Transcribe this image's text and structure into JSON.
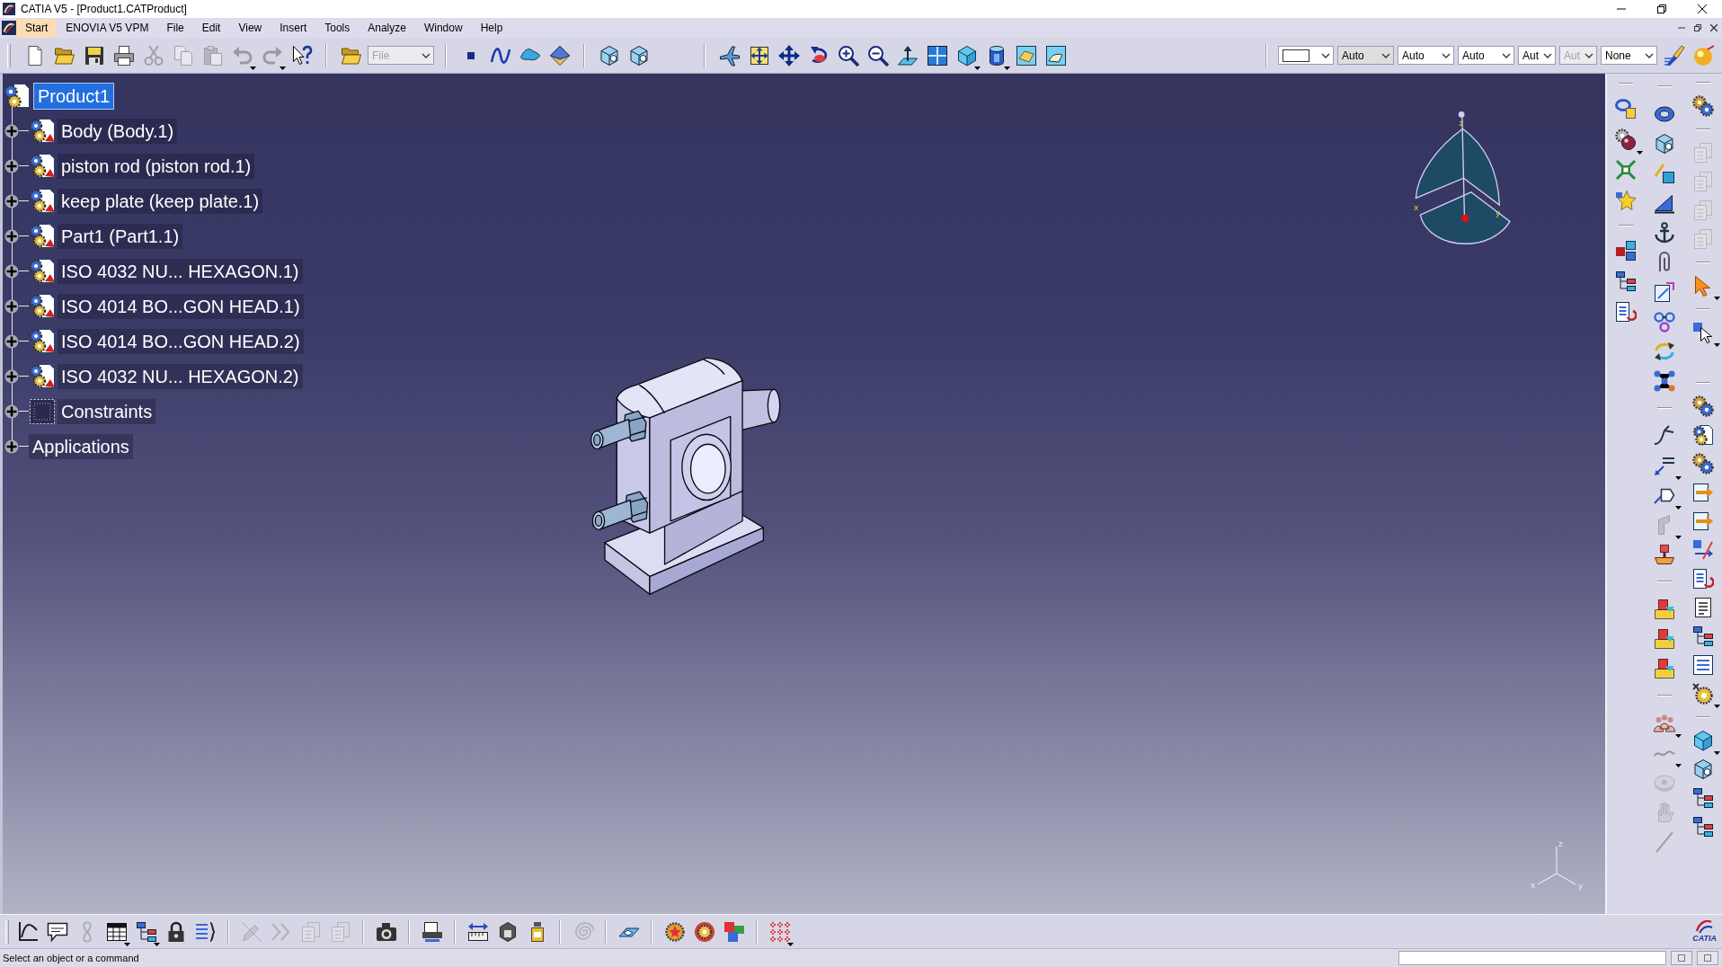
{
  "window": {
    "title": "CATIA V5 - [Product1.CATProduct]"
  },
  "menu": [
    {
      "label": "Start",
      "selected": true
    },
    {
      "label": "ENOVIA V5 VPM",
      "selected": false
    },
    {
      "label": "File",
      "selected": false
    },
    {
      "label": "Edit",
      "selected": false
    },
    {
      "label": "View",
      "selected": false
    },
    {
      "label": "Insert",
      "selected": false
    },
    {
      "label": "Tools",
      "selected": false
    },
    {
      "label": "Analyze",
      "selected": false
    },
    {
      "label": "Window",
      "selected": false
    },
    {
      "label": "Help",
      "selected": false
    }
  ],
  "top_toolbar": {
    "groups": [
      [
        {
          "kind": "doc",
          "disabled": false,
          "dropdown": false
        },
        {
          "kind": "folder",
          "disabled": false,
          "dropdown": false
        },
        {
          "kind": "floppy",
          "disabled": false,
          "dropdown": false
        },
        {
          "kind": "printer",
          "disabled": false,
          "dropdown": false
        },
        {
          "kind": "scissors",
          "disabled": true,
          "dropdown": false
        },
        {
          "kind": "copy",
          "disabled": true,
          "dropdown": false
        },
        {
          "kind": "clipboard",
          "disabled": true,
          "dropdown": false
        },
        {
          "kind": "undo",
          "disabled": true,
          "dropdown": true
        },
        {
          "kind": "redo",
          "disabled": true,
          "dropdown": true
        },
        {
          "kind": "help",
          "disabled": false,
          "dropdown": false
        }
      ],
      [
        {
          "kind": "folder",
          "disabled": false,
          "dropdown": false
        },
        {
          "kind": "combo",
          "value": "File",
          "disabled": true,
          "dropdown": true
        }
      ],
      [
        {
          "kind": "dot",
          "disabled": false,
          "dropdown": false
        },
        {
          "kind": "curve",
          "disabled": false,
          "dropdown": false
        },
        {
          "kind": "surface",
          "disabled": false,
          "dropdown": false
        },
        {
          "kind": "diamond",
          "disabled": false,
          "dropdown": false
        }
      ],
      [
        {
          "kind": "box",
          "disabled": false,
          "dropdown": false
        },
        {
          "kind": "box",
          "disabled": false,
          "dropdown": false
        }
      ],
      [
        {
          "kind": "airplane",
          "disabled": false,
          "dropdown": false
        },
        {
          "kind": "frame-arrows",
          "disabled": false,
          "dropdown": false
        },
        {
          "kind": "move-arrows",
          "disabled": false,
          "dropdown": false
        },
        {
          "kind": "rotate",
          "disabled": false,
          "dropdown": false
        },
        {
          "kind": "zoom-in",
          "disabled": false,
          "dropdown": false
        },
        {
          "kind": "zoom-out",
          "disabled": false,
          "dropdown": false
        },
        {
          "kind": "plane-arrow",
          "disabled": false,
          "dropdown": false
        },
        {
          "kind": "grid",
          "disabled": false,
          "dropdown": false
        },
        {
          "kind": "cube",
          "disabled": false,
          "dropdown": true
        },
        {
          "kind": "cylinder",
          "disabled": false,
          "dropdown": true
        },
        {
          "kind": "tile-diamond",
          "disabled": false,
          "dropdown": false
        },
        {
          "kind": "tile-curve",
          "disabled": false,
          "dropdown": false
        }
      ],
      [
        {
          "kind": "color-combo",
          "disabled": false,
          "dropdown": true
        },
        {
          "kind": "readonly-combo",
          "value": "Auto",
          "disabled": false,
          "dropdown": true
        },
        {
          "kind": "combo",
          "value": "Auto",
          "disabled": false,
          "dropdown": true
        },
        {
          "kind": "combo",
          "value": "Auto",
          "disabled": false,
          "dropdown": true
        },
        {
          "kind": "combo",
          "value": "Aut",
          "disabled": false,
          "dropdown": true
        },
        {
          "kind": "combo",
          "value": "Aut",
          "disabled": true,
          "dropdown": true
        },
        {
          "kind": "combo",
          "value": "None",
          "disabled": false,
          "dropdown": true
        },
        {
          "kind": "brush",
          "disabled": false,
          "dropdown": false
        },
        {
          "kind": "sphere",
          "disabled": false,
          "dropdown": false
        }
      ]
    ]
  },
  "tree": {
    "root": {
      "label": "Product1",
      "kind": "product",
      "selected": true,
      "children": [
        {
          "label": "Body (Body.1)",
          "kind": "part",
          "selected": false,
          "expanded": false
        },
        {
          "label": "piston rod (piston rod.1)",
          "kind": "part",
          "selected": false,
          "expanded": false
        },
        {
          "label": "keep plate (keep plate.1)",
          "kind": "part",
          "selected": false,
          "expanded": false
        },
        {
          "label": "Part1 (Part1.1)",
          "kind": "part",
          "selected": false,
          "expanded": false
        },
        {
          "label": "ISO 4032 NU... HEXAGON.1)",
          "kind": "part",
          "selected": false,
          "expanded": false
        },
        {
          "label": "ISO 4014 BO...GON HEAD.1)",
          "kind": "part",
          "selected": false,
          "expanded": false
        },
        {
          "label": "ISO 4014 BO...GON HEAD.2)",
          "kind": "part",
          "selected": false,
          "expanded": false
        },
        {
          "label": "ISO 4032 NU... HEXAGON.2)",
          "kind": "part",
          "selected": false,
          "expanded": false
        },
        {
          "label": "Constraints",
          "kind": "constraints",
          "selected": false,
          "expanded": false
        },
        {
          "label": "Applications",
          "kind": "applications",
          "selected": false,
          "expanded": false
        }
      ]
    }
  },
  "viewer": {
    "compass_labels": [
      "z",
      "x",
      "y"
    ],
    "axis_labels": [
      "z",
      "x",
      "y"
    ]
  },
  "right_toolbars": {
    "columns": [
      [
        [
          {
            "kind": "ring-cube",
            "disabled": false,
            "dropdown": false
          },
          {
            "kind": "gear-ball",
            "disabled": false,
            "dropdown": true
          },
          {
            "kind": "cross-arrows",
            "disabled": false,
            "dropdown": false
          },
          {
            "kind": "star",
            "disabled": false,
            "dropdown": false
          }
        ],
        [
          {
            "kind": "cube-tree",
            "disabled": false,
            "dropdown": false
          },
          {
            "kind": "tree",
            "disabled": false,
            "dropdown": false
          },
          {
            "kind": "list-arrow",
            "disabled": false,
            "dropdown": false
          }
        ]
      ],
      [
        [
          {
            "kind": "ring",
            "disabled": false,
            "dropdown": false
          },
          {
            "kind": "box",
            "disabled": false,
            "dropdown": false
          },
          {
            "kind": "cube-arrow",
            "disabled": false,
            "dropdown": false
          },
          {
            "kind": "ramp",
            "disabled": false,
            "dropdown": false
          },
          {
            "kind": "anchor",
            "disabled": false,
            "dropdown": false
          },
          {
            "kind": "paperclip",
            "disabled": false,
            "dropdown": false
          },
          {
            "kind": "frame-pen",
            "disabled": false,
            "dropdown": false
          },
          {
            "kind": "chain",
            "disabled": false,
            "dropdown": false
          },
          {
            "kind": "sync",
            "disabled": false,
            "dropdown": false
          },
          {
            "kind": "network",
            "disabled": false,
            "dropdown": false
          }
        ],
        [
          {
            "kind": "fork",
            "disabled": false,
            "dropdown": false
          },
          {
            "kind": "label-arrow",
            "disabled": false,
            "dropdown": true
          },
          {
            "kind": "tag",
            "disabled": false,
            "dropdown": true
          },
          {
            "kind": "bracket",
            "disabled": true,
            "dropdown": true
          },
          {
            "kind": "stamp",
            "disabled": false,
            "dropdown": false
          }
        ],
        [
          {
            "kind": "tray",
            "disabled": false,
            "dropdown": false
          },
          {
            "kind": "tray",
            "disabled": false,
            "dropdown": false
          },
          {
            "kind": "tray",
            "disabled": false,
            "dropdown": false
          }
        ],
        [
          {
            "kind": "people",
            "disabled": false,
            "dropdown": true
          },
          {
            "kind": "tilde",
            "disabled": true,
            "dropdown": true
          },
          {
            "kind": "disk",
            "disabled": true,
            "dropdown": false
          },
          {
            "kind": "hand",
            "disabled": true,
            "dropdown": false
          },
          {
            "kind": "slash",
            "disabled": true,
            "dropdown": false
          }
        ]
      ],
      [
        [
          {
            "kind": "gears",
            "disabled": false,
            "dropdown": false
          }
        ],
        [
          {
            "kind": "doc-stack",
            "disabled": true,
            "dropdown": false
          },
          {
            "kind": "doc-stack",
            "disabled": true,
            "dropdown": false
          },
          {
            "kind": "doc-stack",
            "disabled": true,
            "dropdown": false
          },
          {
            "kind": "doc-stack",
            "disabled": true,
            "dropdown": false
          }
        ],
        [
          {
            "kind": "pointer",
            "disabled": false,
            "dropdown": true
          }
        ],
        [
          {
            "kind": "pointer-cube",
            "disabled": false,
            "dropdown": true
          }
        ],
        [
          {
            "kind": "gears",
            "disabled": false,
            "dropdown": false
          },
          {
            "kind": "gear-doc",
            "disabled": false,
            "dropdown": false
          },
          {
            "kind": "gears",
            "disabled": false,
            "dropdown": false
          },
          {
            "kind": "doc-arrow",
            "disabled": false,
            "dropdown": false
          },
          {
            "kind": "doc-arrow",
            "disabled": false,
            "dropdown": false
          },
          {
            "kind": "swap-arrows",
            "disabled": false,
            "dropdown": false
          },
          {
            "kind": "list-arrow",
            "disabled": false,
            "dropdown": false
          },
          {
            "kind": "doc-lines",
            "disabled": false,
            "dropdown": false
          },
          {
            "kind": "tree",
            "disabled": false,
            "dropdown": false
          },
          {
            "kind": "list",
            "disabled": false,
            "dropdown": false
          },
          {
            "kind": "gear-x",
            "disabled": false,
            "dropdown": true
          }
        ],
        [
          {
            "kind": "cube",
            "disabled": false,
            "dropdown": true
          },
          {
            "kind": "box",
            "disabled": false,
            "dropdown": false
          },
          {
            "kind": "tree",
            "disabled": false,
            "dropdown": false
          },
          {
            "kind": "tree",
            "disabled": false,
            "dropdown": false
          }
        ]
      ]
    ]
  },
  "bottom_toolbar": {
    "groups": [
      [
        {
          "kind": "function-graph",
          "disabled": false,
          "dropdown": false
        },
        {
          "kind": "speech",
          "disabled": false,
          "dropdown": false
        },
        {
          "kind": "loop",
          "disabled": true,
          "dropdown": false
        },
        {
          "kind": "table",
          "disabled": false,
          "dropdown": true
        },
        {
          "kind": "tree",
          "disabled": false,
          "dropdown": true
        },
        {
          "kind": "lock",
          "disabled": false,
          "dropdown": false
        },
        {
          "kind": "brace-list",
          "disabled": false,
          "dropdown": false
        }
      ],
      [
        {
          "kind": "pencil",
          "disabled": true,
          "dropdown": false
        },
        {
          "kind": "chevrons",
          "disabled": true,
          "dropdown": false
        },
        {
          "kind": "doc-stack",
          "disabled": true,
          "dropdown": false
        },
        {
          "kind": "doc-stack",
          "disabled": true,
          "dropdown": false
        }
      ],
      [
        {
          "kind": "camera",
          "disabled": false,
          "dropdown": false
        }
      ],
      [
        {
          "kind": "scanner",
          "disabled": false,
          "dropdown": false
        }
      ],
      [
        {
          "kind": "ruler",
          "disabled": false,
          "dropdown": false
        },
        {
          "kind": "block",
          "disabled": false,
          "dropdown": false
        },
        {
          "kind": "bottle",
          "disabled": false,
          "dropdown": false
        }
      ],
      [
        {
          "kind": "spiral",
          "disabled": true,
          "dropdown": false
        }
      ],
      [
        {
          "kind": "plane-cube",
          "disabled": false,
          "dropdown": false
        }
      ],
      [
        {
          "kind": "gear-star",
          "disabled": false,
          "dropdown": false
        },
        {
          "kind": "sphere-gear",
          "disabled": false,
          "dropdown": false
        },
        {
          "kind": "cubes",
          "disabled": false,
          "dropdown": false
        }
      ],
      [
        {
          "kind": "dots-grid",
          "disabled": false,
          "dropdown": true
        }
      ]
    ],
    "logo_text": "CATIA"
  },
  "status_bar": {
    "message": "Select an object or a command"
  }
}
